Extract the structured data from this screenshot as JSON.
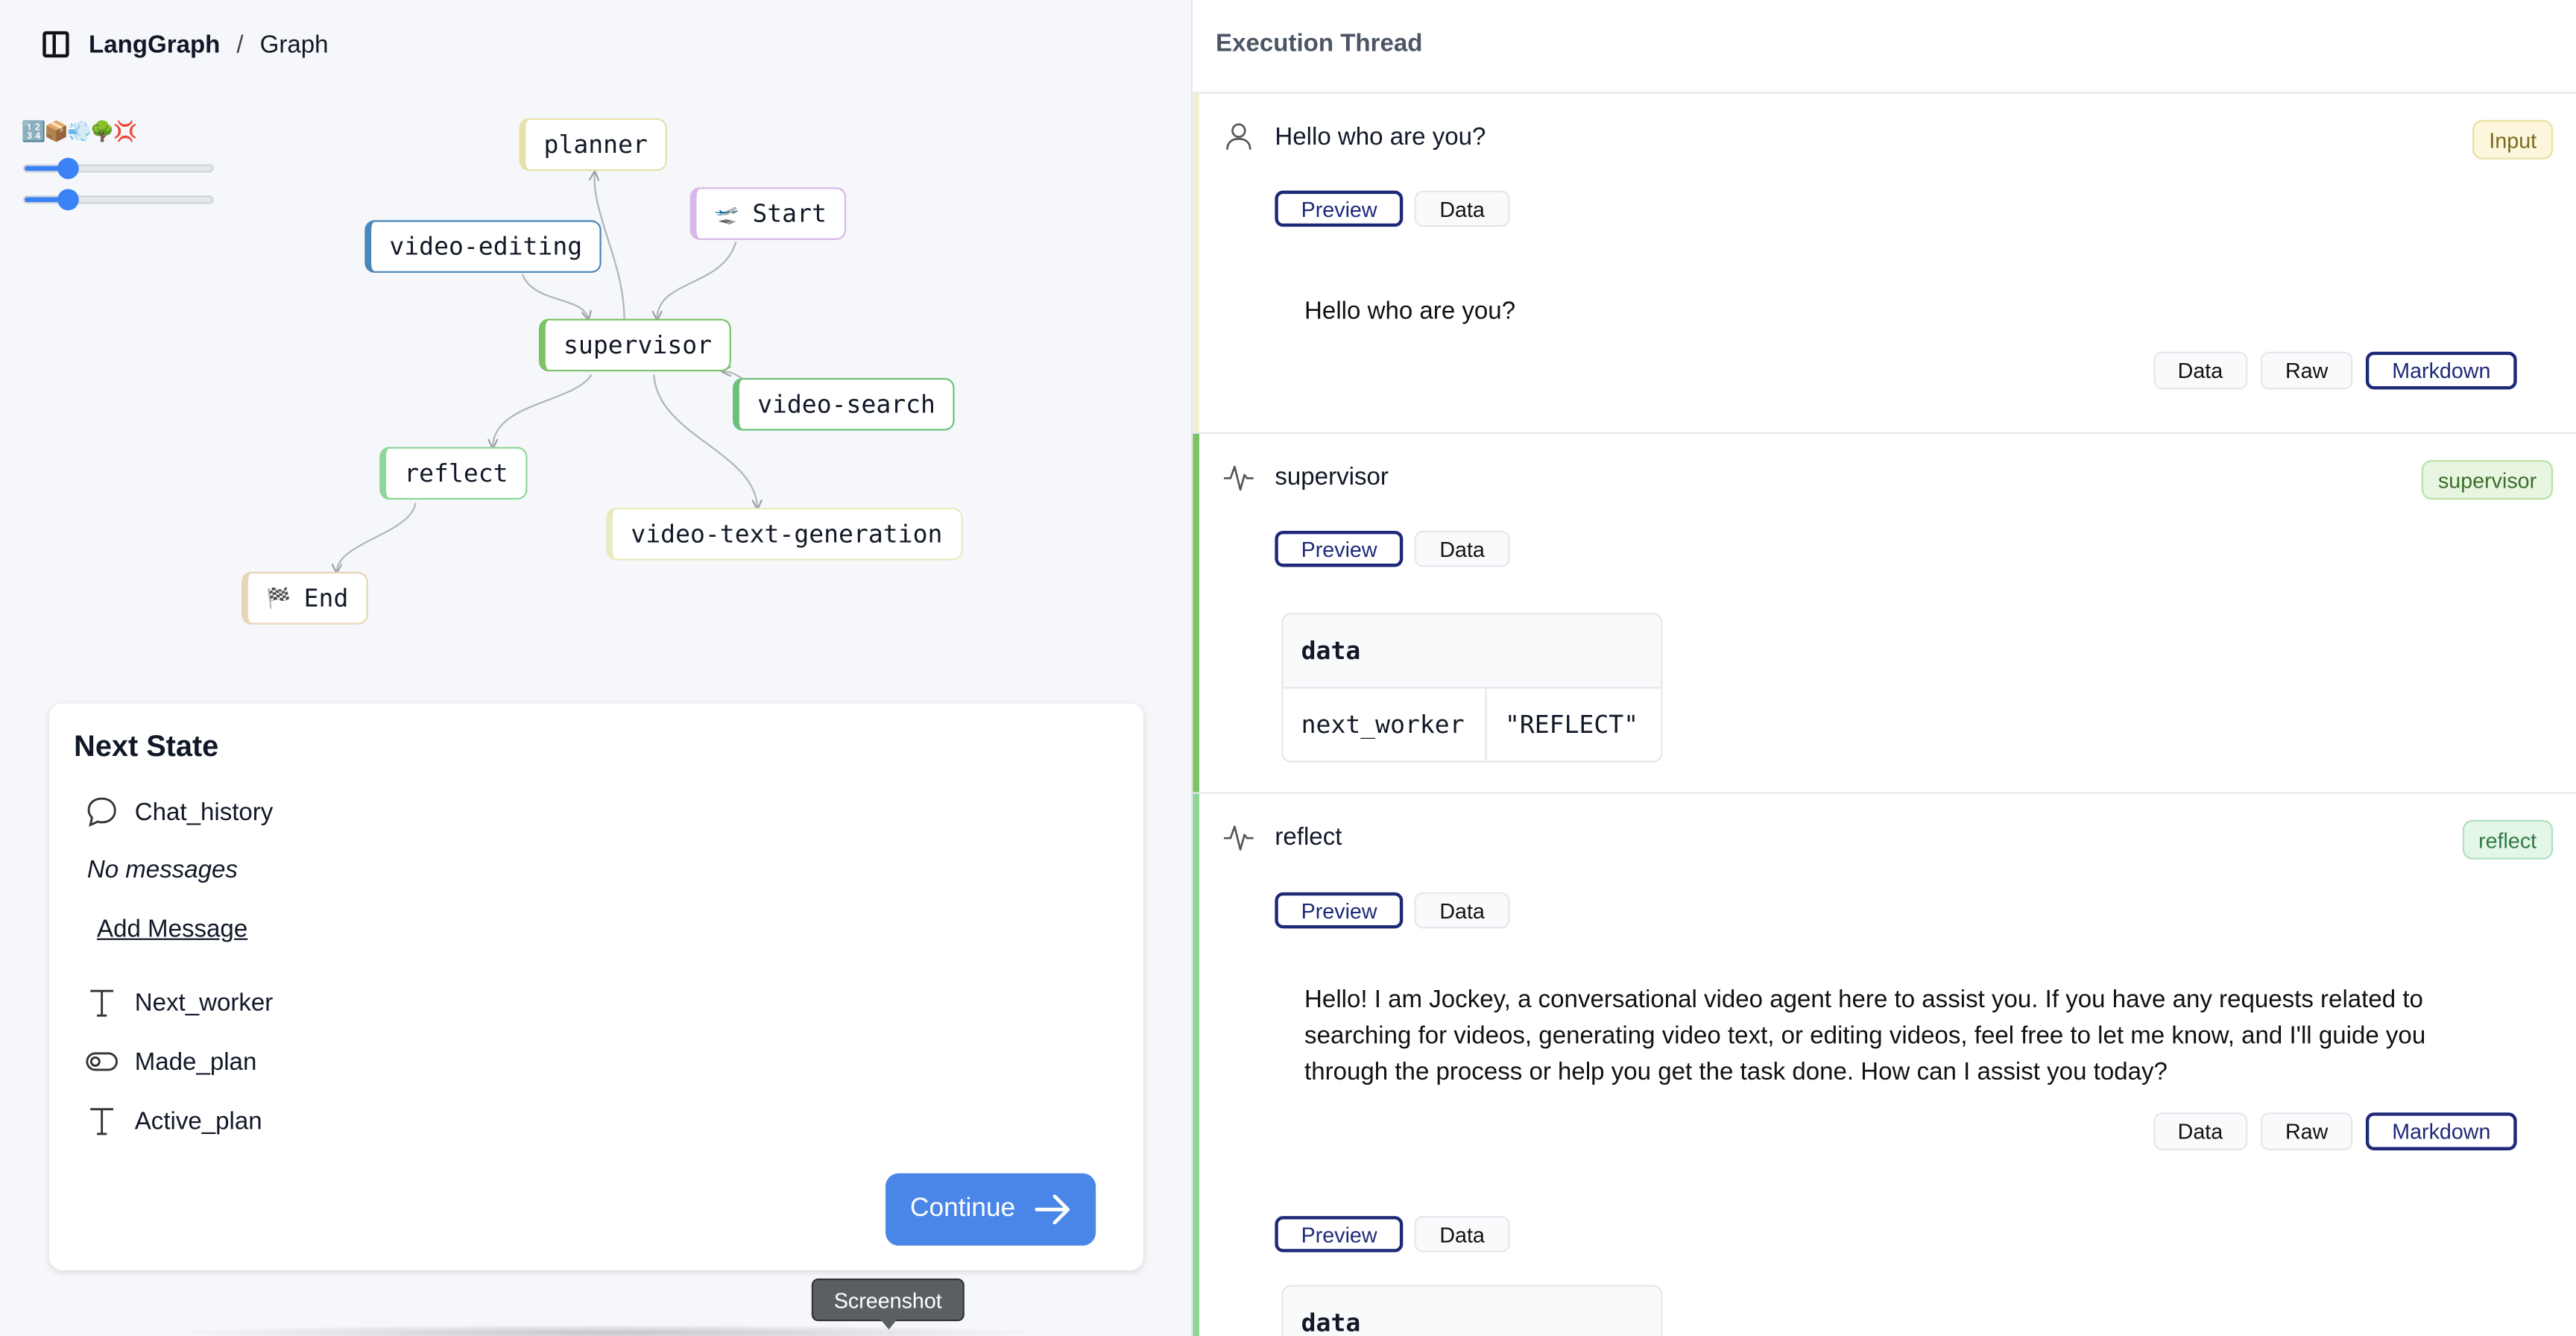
{
  "header": {
    "brand": "LangGraph",
    "separator": "/",
    "page": "Graph"
  },
  "controls": {
    "emojis": "🔢📦💨🌳💢",
    "zoom_slider": 0.23,
    "spacing_slider": 0.23
  },
  "graph": {
    "nodes": [
      {
        "id": "planner",
        "label": "planner",
        "color": "#e8e0a8"
      },
      {
        "id": "start",
        "label": "Start",
        "icon": "🛫",
        "color": "#d8b8e8"
      },
      {
        "id": "video_editing",
        "label": "video-editing",
        "color": "#4a86b8"
      },
      {
        "id": "supervisor",
        "label": "supervisor",
        "color": "#7cc267"
      },
      {
        "id": "video_search",
        "label": "video-search",
        "color": "#6cc07a"
      },
      {
        "id": "reflect",
        "label": "reflect",
        "color": "#8fd69a"
      },
      {
        "id": "video_text_generation",
        "label": "video-text-generation",
        "color": "#eaeac0"
      },
      {
        "id": "end",
        "label": "End",
        "icon": "🏁",
        "color": "#e6d6b8"
      }
    ]
  },
  "next_state": {
    "title": "Next State",
    "chat_history": "Chat_history",
    "no_messages": "No messages",
    "add_message": "Add Message",
    "next_worker": "Next_worker",
    "made_plan": "Made_plan",
    "active_plan": "Active_plan",
    "continue": "Continue"
  },
  "tooltip": "Screenshot",
  "thread": {
    "title": "Execution Thread",
    "entries": [
      {
        "name": "Hello who are you?",
        "badge": "Input",
        "tabs": [
          "Preview",
          "Data"
        ],
        "message": "Hello who are you?",
        "views": [
          "Data",
          "Raw",
          "Markdown"
        ],
        "bar_color": "#f1efcf",
        "badge_bg": "#fbf6dc",
        "badge_border": "#e8dfa0",
        "badge_text": "#7a6a20"
      },
      {
        "name": "supervisor",
        "badge": "supervisor",
        "tabs": [
          "Preview",
          "Data"
        ],
        "table_head": "data",
        "table_key": "next_worker",
        "table_value": "\"REFLECT\"",
        "bar_color": "#7cc267",
        "badge_bg": "#e8f5e0",
        "badge_border": "#bfe0a8",
        "badge_text": "#3b6e2a"
      },
      {
        "name": "reflect",
        "badge": "reflect",
        "tabs": [
          "Preview",
          "Data"
        ],
        "message": "Hello! I am Jockey, a conversational video agent here to assist you. If you have any requests related to searching for videos, generating video text, or editing videos, feel free to let me know, and I'll guide you through the process or help you get the task done. How can I assist you today?",
        "views": [
          "Data",
          "Raw",
          "Markdown"
        ],
        "tabs2": [
          "Preview",
          "Data"
        ],
        "table_head": "data",
        "bar_color": "#8fd69a",
        "badge_bg": "#e4f6e8",
        "badge_border": "#b0e0bb",
        "badge_text": "#2f7a44"
      }
    ]
  }
}
